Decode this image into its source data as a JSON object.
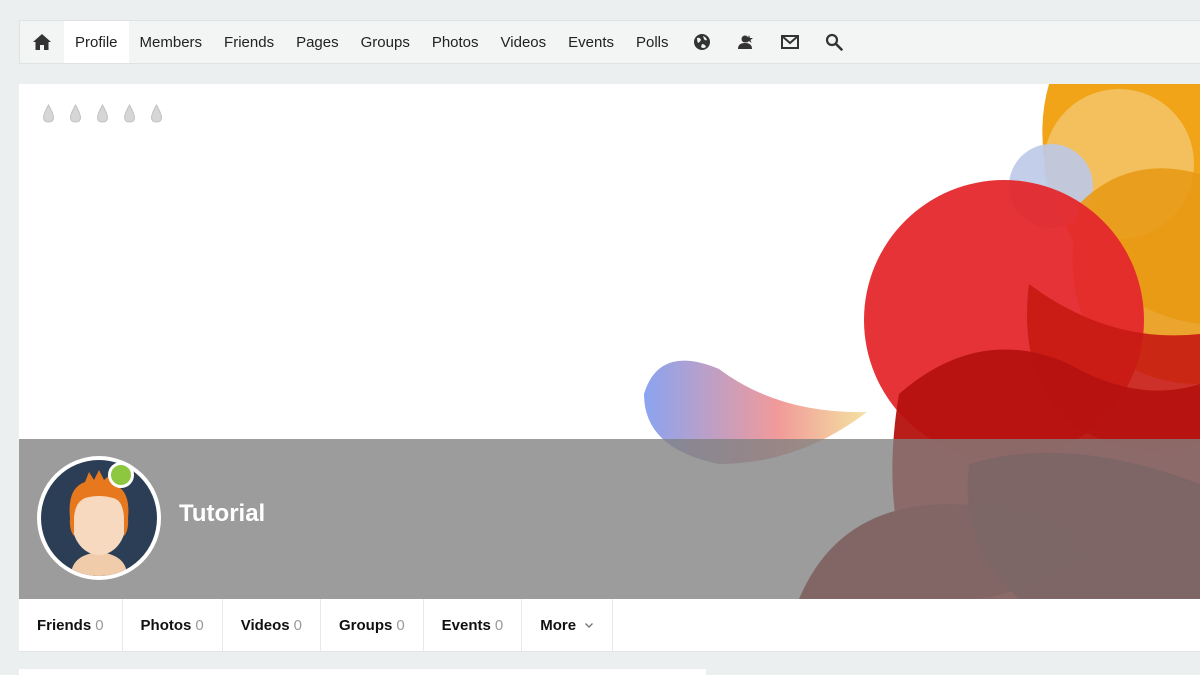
{
  "nav": {
    "items": [
      {
        "label": "Profile",
        "active": true
      },
      {
        "label": "Members"
      },
      {
        "label": "Friends"
      },
      {
        "label": "Pages"
      },
      {
        "label": "Groups"
      },
      {
        "label": "Photos"
      },
      {
        "label": "Videos"
      },
      {
        "label": "Events"
      },
      {
        "label": "Polls"
      }
    ],
    "icons": [
      "globe-icon",
      "friend-requests-icon",
      "mail-icon",
      "search-icon"
    ]
  },
  "cover": {
    "rating_icons": [
      "drop-icon",
      "drop-icon",
      "drop-icon",
      "drop-icon",
      "drop-icon"
    ]
  },
  "profile": {
    "name": "Tutorial",
    "status": "online",
    "status_color": "#8dc63f"
  },
  "tabs": [
    {
      "label": "Friends",
      "count": "0"
    },
    {
      "label": "Photos",
      "count": "0"
    },
    {
      "label": "Videos",
      "count": "0"
    },
    {
      "label": "Groups",
      "count": "0"
    },
    {
      "label": "Events",
      "count": "0"
    },
    {
      "label": "More",
      "count": ""
    }
  ],
  "colors": {
    "accent_online": "#8dc63f",
    "nav_bg": "#f3f4f4",
    "page_bg": "#eceff0"
  }
}
